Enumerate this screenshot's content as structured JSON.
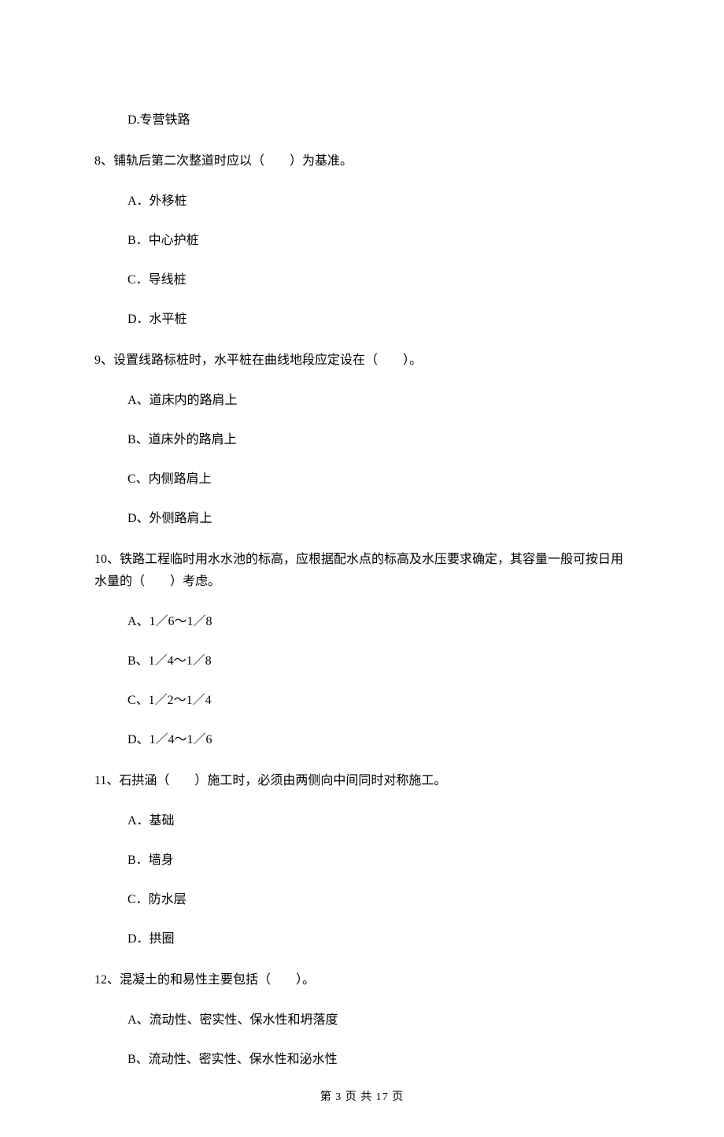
{
  "items": [
    {
      "type": "option",
      "text": "D.专营铁路"
    },
    {
      "type": "question",
      "text": "8、铺轨后第二次整道时应以（　　）为基准。"
    },
    {
      "type": "option",
      "text": "A．外移桩"
    },
    {
      "type": "option",
      "text": "B．中心护桩"
    },
    {
      "type": "option",
      "text": "C．导线桩"
    },
    {
      "type": "option",
      "text": "D．水平桩"
    },
    {
      "type": "question",
      "text": "9、设置线路标桩时，水平桩在曲线地段应定设在（　　）。"
    },
    {
      "type": "option",
      "text": "A、道床内的路肩上"
    },
    {
      "type": "option",
      "text": "B、道床外的路肩上"
    },
    {
      "type": "option",
      "text": "C、内侧路肩上"
    },
    {
      "type": "option",
      "text": "D、外侧路肩上"
    },
    {
      "type": "question",
      "text": "10、铁路工程临时用水水池的标高，应根据配水点的标高及水压要求确定，其容量一般可按日用水量的（　　）考虑。"
    },
    {
      "type": "option",
      "text": "A、1／6～1／8"
    },
    {
      "type": "option",
      "text": "B、1／4～1／8"
    },
    {
      "type": "option",
      "text": "C、1／2～1／4"
    },
    {
      "type": "option",
      "text": "D、1／4～1／6"
    },
    {
      "type": "question",
      "text": "11、石拱涵（　　）施工时，必须由两侧向中间同时对称施工。"
    },
    {
      "type": "option",
      "text": "A．基础"
    },
    {
      "type": "option",
      "text": "B．墙身"
    },
    {
      "type": "option",
      "text": "C．防水层"
    },
    {
      "type": "option",
      "text": "D．拱圈"
    },
    {
      "type": "question",
      "text": "12、混凝土的和易性主要包括（　　）。"
    },
    {
      "type": "option",
      "text": "A、流动性、密实性、保水性和坍落度"
    },
    {
      "type": "option",
      "text": "B、流动性、密实性、保水性和泌水性"
    }
  ],
  "footer": "第 3 页 共 17 页"
}
